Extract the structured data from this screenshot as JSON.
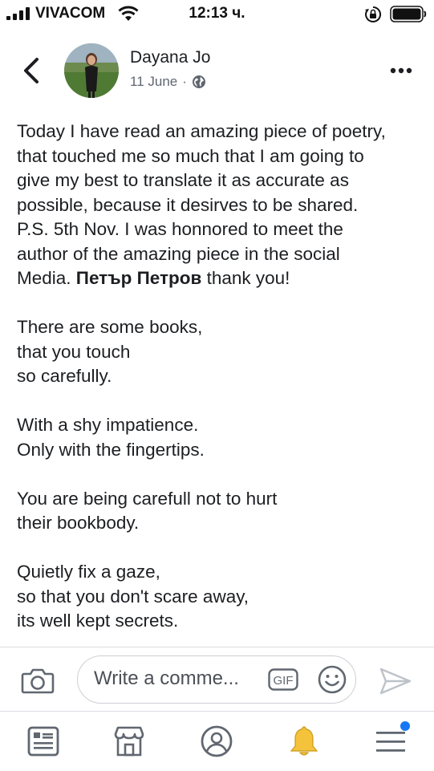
{
  "status_bar": {
    "carrier": "VIVACOM",
    "time": "12:13 ч."
  },
  "post": {
    "author": "Dayana Jo",
    "date": "11 June",
    "separator": "·",
    "paragraph1_lines": [
      "Today I have read an amazing piece of poetry,",
      "that touched me so much that I am going to",
      "give my best to translate it as accurate as",
      "possible, because it desirves to be shared.",
      "P.S. 5th Nov. I was honnored to meet the",
      "author of the amazing piece in the social"
    ],
    "last_line_prefix": "Media. ",
    "mention": "Петър Петров",
    "last_line_suffix": " thank you!",
    "stanzas": [
      [
        "There are some books,",
        "that you touch",
        "so carefully."
      ],
      [
        "With a shy impatience.",
        "Only with the fingertips."
      ],
      [
        "You are being carefull not to hurt",
        "their bookbody."
      ],
      [
        "Quietly fix a gaze,",
        "so that you don't scare away,",
        "its well kept secrets."
      ]
    ]
  },
  "comment_bar": {
    "placeholder": "Write a comme...",
    "gif_label": "GIF"
  },
  "tabs": [
    "news-feed",
    "marketplace",
    "profile",
    "notifications",
    "menu"
  ],
  "colors": {
    "text": "#1c1e21",
    "secondary": "#606770",
    "icon_gray": "#606770",
    "bell": "#f5c33b",
    "accent": "#1877f2"
  }
}
